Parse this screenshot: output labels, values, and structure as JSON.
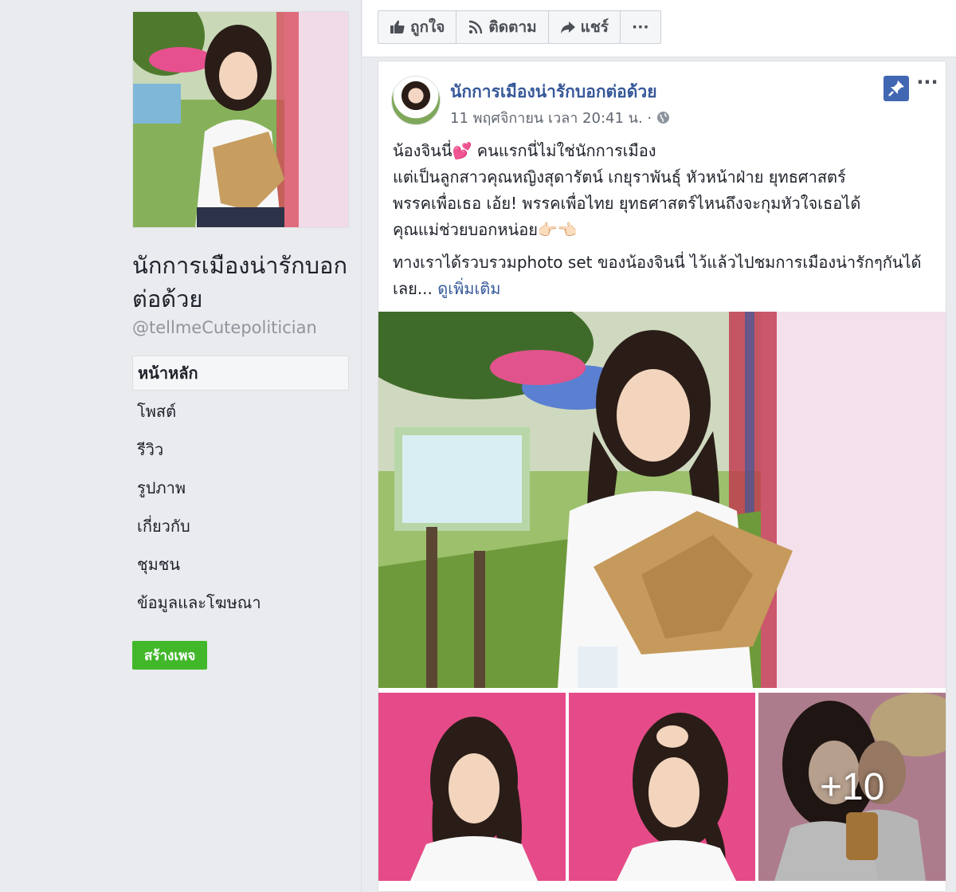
{
  "page": {
    "name": "นักการเมืองน่ารักบอกต่อด้วย",
    "handle": "@tellmeCutepolitician"
  },
  "nav": {
    "items": [
      {
        "label": "หน้าหลัก"
      },
      {
        "label": "โพสต์"
      },
      {
        "label": "รีวิว"
      },
      {
        "label": "รูปภาพ"
      },
      {
        "label": "เกี่ยวกับ"
      },
      {
        "label": "ชุมชน"
      },
      {
        "label": "ข้อมูลและโฆษณา"
      }
    ],
    "active_index": 0
  },
  "create_page_label": "สร้างเพจ",
  "actions": {
    "like": "ถูกใจ",
    "follow": "ติดตาม",
    "share": "แชร์",
    "more": "···"
  },
  "post": {
    "author": "นักการเมืองน่ารักบอกต่อด้วย",
    "timestamp": "11 พฤศจิกายน เวลา 20:41 น. ·",
    "line1": "น้องจินนี่💕 คนแรกนี่ไม่ใช่นักการเมือง",
    "line2": "แต่เป็นลูกสาวคุณหญิงสุดารัตน์ เกยุราพันธุ์ หัวหน้าฝ่าย ยุทธศาสตร์",
    "line3": "พรรคเพื่อเธอ เอ้ย! พรรคเพื่อไทย ยุทธศาสตร์ไหนถึงจะกุมหัวใจเธอได้",
    "line4": "คุณแม่ช่วยบอกหน่อย👉🏻👈🏻",
    "para2": "ทางเราได้รวบรวมphoto set ของน้องจินนี่ ไว้แล้วไปชมการเมืองน่ารักๆกันได้เลย... ",
    "see_more": "ดูเพิ่มเติม",
    "more_photos": "+10",
    "more_menu": "···"
  },
  "colors": {
    "background": "#e9ebee",
    "link": "#365899",
    "green": "#42b72a",
    "pin_blue": "#4267b2"
  }
}
